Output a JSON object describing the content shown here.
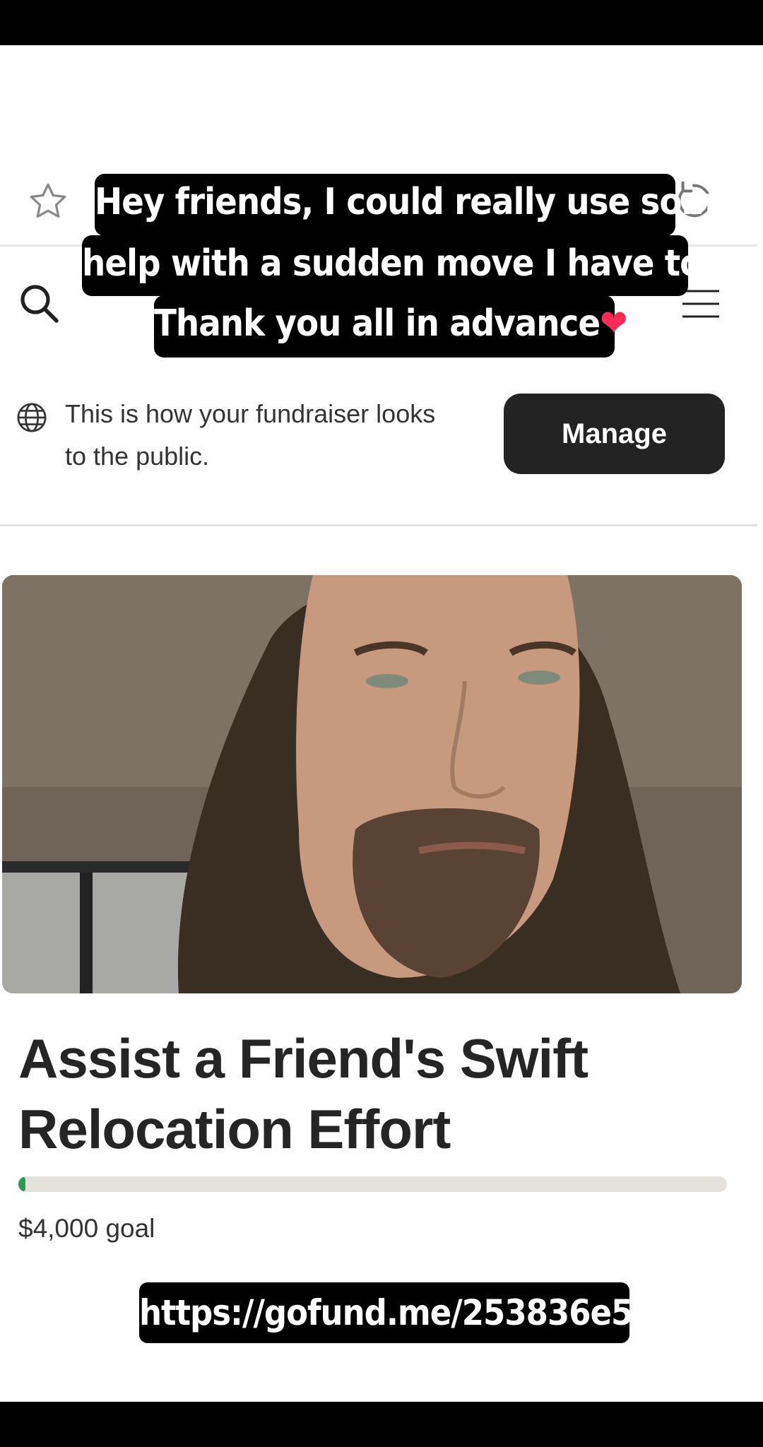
{
  "caption": {
    "line1": "Hey friends, I could really use some",
    "line2": "help with a sudden move I have to do.",
    "line3": "Thank you all in advance",
    "emoji": "❤"
  },
  "icons": {
    "favorite": "star-icon",
    "reload": "reload-icon",
    "search": "search-icon",
    "menu": "hamburger-menu-icon",
    "globe": "globe-icon"
  },
  "notice": {
    "text": "This is how your fundraiser looks to the public.",
    "manage_label": "Manage"
  },
  "fundraiser": {
    "title": "Assist a Friend's Swift Relocation Effort",
    "goal_text": "$4,000 goal",
    "progress_fraction": 0.01,
    "progress_color": "#2d9a4e"
  },
  "link_overlay": {
    "url": "https://gofund.me/253836e5"
  }
}
